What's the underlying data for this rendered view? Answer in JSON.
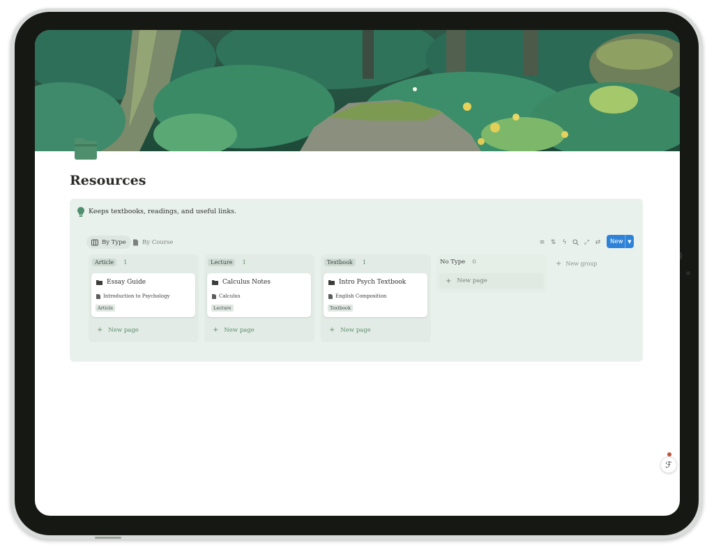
{
  "page": {
    "title": "Resources",
    "callout_text": "Keeps textbooks, readings, and useful links."
  },
  "views": [
    {
      "label": "By Type",
      "active": true
    },
    {
      "label": "By Course",
      "active": false
    }
  ],
  "toolbar": {
    "icons": [
      "filter-icon",
      "sort-icon",
      "automation-icon",
      "search-icon",
      "expand-icon",
      "settings-icon"
    ],
    "new_label": "New"
  },
  "board": {
    "columns": [
      {
        "tag": "Article",
        "count": "1",
        "card": {
          "title": "Essay Guide",
          "relation": "Introduction to Psychology",
          "type": "Article"
        },
        "new_page": "New page"
      },
      {
        "tag": "Lecture",
        "count": "1",
        "card": {
          "title": "Calculus Notes",
          "relation": "Calculus",
          "type": "Lecture"
        },
        "new_page": "New page"
      },
      {
        "tag": "Textbook",
        "count": "1",
        "card": {
          "title": "Intro Psych Textbook",
          "relation": "English Composition",
          "type": "Textbook"
        },
        "new_page": "New page"
      },
      {
        "tag": "No Type",
        "count": "0",
        "new_page": "New page"
      }
    ],
    "new_group": "New group"
  },
  "colors": {
    "accent": "#2e83d8",
    "callout_bg": "#e9f1ec",
    "green_text": "#5c8f6b"
  }
}
